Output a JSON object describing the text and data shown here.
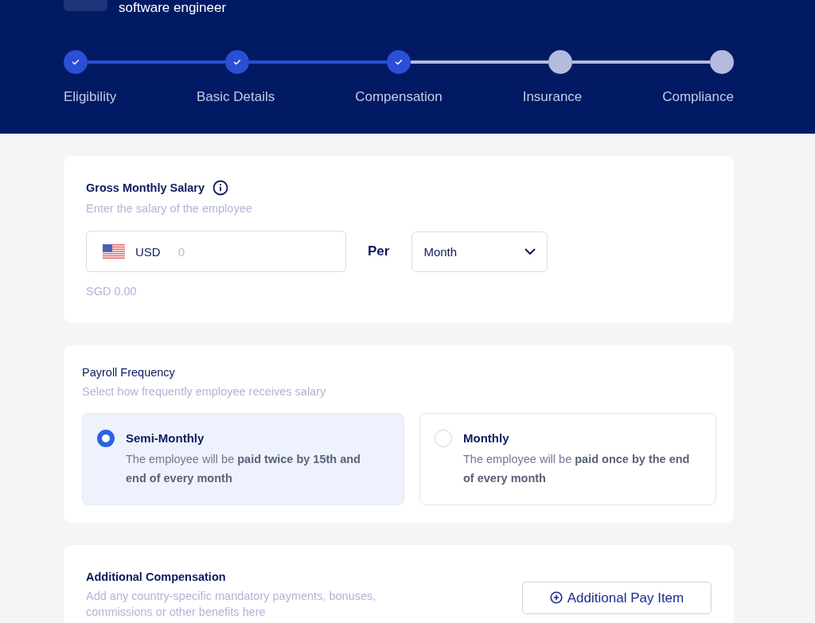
{
  "header": {
    "subtitle": "software engineer"
  },
  "steps": [
    {
      "label": "Eligibility",
      "done": true
    },
    {
      "label": "Basic Details",
      "done": true
    },
    {
      "label": "Compensation",
      "done": true
    },
    {
      "label": "Insurance",
      "done": false
    },
    {
      "label": "Compliance",
      "done": false
    }
  ],
  "salary": {
    "title": "Gross Monthly Salary",
    "hint": "Enter the salary of the employee",
    "currency": "USD",
    "placeholder": "0",
    "per_label": "Per",
    "period": "Month",
    "converted": "SGD 0.00"
  },
  "payroll": {
    "title": "Payroll Frequency",
    "hint": "Select how frequently employee receives salary",
    "options": [
      {
        "title": "Semi-Monthly",
        "description": "The employee will be **paid twice by 15th and end of every month**",
        "selected": true
      },
      {
        "title": "Monthly",
        "description": "The employee will be **paid once by the end of every month**",
        "selected": false
      }
    ]
  },
  "additional": {
    "title": "Additional Compensation",
    "hint": "Add any country-specific mandatory payments, bonuses, commissions or other benefits here",
    "button": "Additional Pay Item"
  }
}
